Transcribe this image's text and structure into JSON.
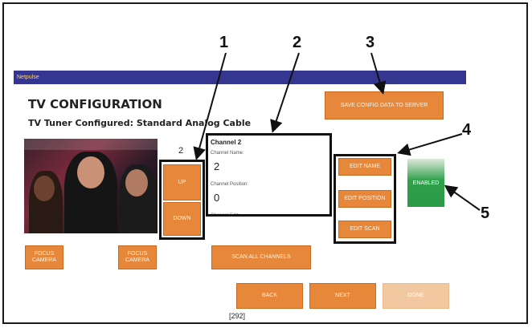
{
  "app": {
    "brand": "Netpulse"
  },
  "page": {
    "title": "TV CONFIGURATION",
    "tuner_status": "TV Tuner Configured: Standard Analog Cable",
    "page_code": "[292]"
  },
  "channel": {
    "current_number": "2",
    "header": "Channel 2",
    "name_label": "Channel Name:",
    "name_value": "2",
    "position_label": "Channel Position:",
    "position_value": "0",
    "extra_label": "Channel Edit:"
  },
  "buttons": {
    "save_config": "SAVE CONFIG DATA TO SERVER",
    "up": "UP",
    "down": "DOWN",
    "auto_adjust_left": "FOCUS CAMERA",
    "auto_adjust_right": "FOCUS CAMERA",
    "edit_name": "EDIT NAME",
    "edit_position": "EDIT POSITION",
    "edit_scan": "EDIT SCAN",
    "scan_all": "SCAN ALL CHANNELS",
    "back": "BACK",
    "next": "NEXT",
    "done": "DONE"
  },
  "status": {
    "enabled": "ENABLED"
  },
  "callouts": [
    "1",
    "2",
    "3",
    "4",
    "5"
  ],
  "colors": {
    "header_bar": "#35368f",
    "button_orange": "#e6873a",
    "enabled_green": "#2fa04b"
  }
}
